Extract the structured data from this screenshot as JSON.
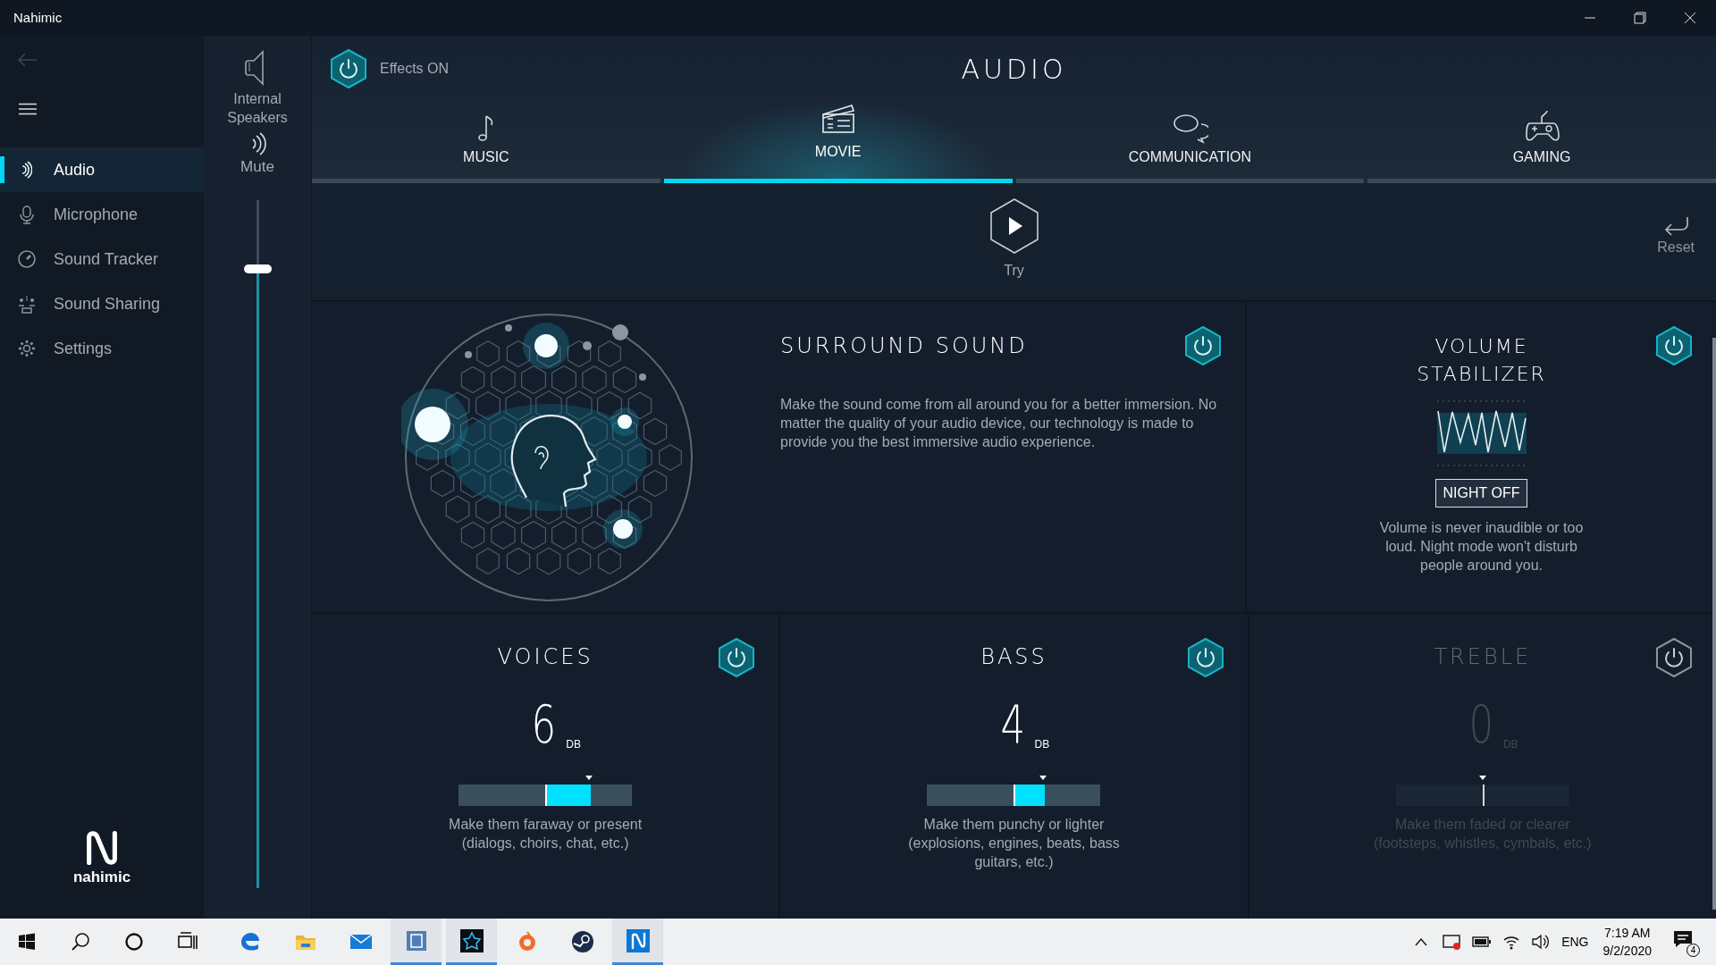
{
  "window": {
    "title": "Nahimic"
  },
  "logo": {
    "text": "nahimic"
  },
  "sidebar": {
    "items": [
      {
        "label": "Audio",
        "selected": true
      },
      {
        "label": "Microphone",
        "selected": false
      },
      {
        "label": "Sound Tracker",
        "selected": false
      },
      {
        "label": "Sound Sharing",
        "selected": false
      },
      {
        "label": "Settings",
        "selected": false
      }
    ]
  },
  "device": {
    "name": "Internal Speakers",
    "mute_label": "Mute",
    "level": 0.9
  },
  "effects": {
    "label": "Effects ON",
    "on": true
  },
  "title": "AUDIO",
  "tabs": [
    {
      "label": "MUSIC",
      "selected": false
    },
    {
      "label": "MOVIE",
      "selected": true
    },
    {
      "label": "COMMUNICATION",
      "selected": false
    },
    {
      "label": "GAMING",
      "selected": false
    }
  ],
  "try": {
    "label": "Try"
  },
  "reset": {
    "label": "Reset"
  },
  "surround": {
    "title": "SURROUND SOUND",
    "on": true,
    "description": "Make the sound come from all around you for a better immersion. No matter the quality of your audio device, our technology is made to provide you the best immersive audio experience."
  },
  "stabilizer": {
    "title": "VOLUME STABILIZER",
    "on": true,
    "night_button": "NIGHT OFF",
    "description": "Volume is never inaudible or too loud. Night mode won't disturb people around you."
  },
  "equalizers": [
    {
      "title": "VOICES",
      "on": true,
      "value": "6",
      "unit": "DB",
      "level": 0.75,
      "description": "Make them faraway or present (dialogs, choirs, chat, etc.)"
    },
    {
      "title": "BASS",
      "on": true,
      "value": "4",
      "unit": "DB",
      "level": 0.667,
      "description": "Make them punchy or lighter (explosions, engines, beats, bass guitars, etc.)"
    },
    {
      "title": "TREBLE",
      "on": false,
      "value": "0",
      "unit": "DB",
      "level": 0.5,
      "description": "Make them faded or clearer (footsteps, whistles, cymbals, etc.)"
    }
  ],
  "taskbar": {
    "apps": [
      {
        "kind": "browser",
        "running": false
      },
      {
        "kind": "folder",
        "running": false
      },
      {
        "kind": "mail",
        "running": false
      },
      {
        "kind": "square",
        "running": true
      },
      {
        "kind": "star",
        "running": true
      },
      {
        "kind": "ring",
        "running": false
      },
      {
        "kind": "steam",
        "running": false
      },
      {
        "kind": "wave",
        "running": true
      }
    ],
    "language": "ENG",
    "time": "7:19 AM",
    "date": "9/2/2020",
    "notifications": "4"
  }
}
